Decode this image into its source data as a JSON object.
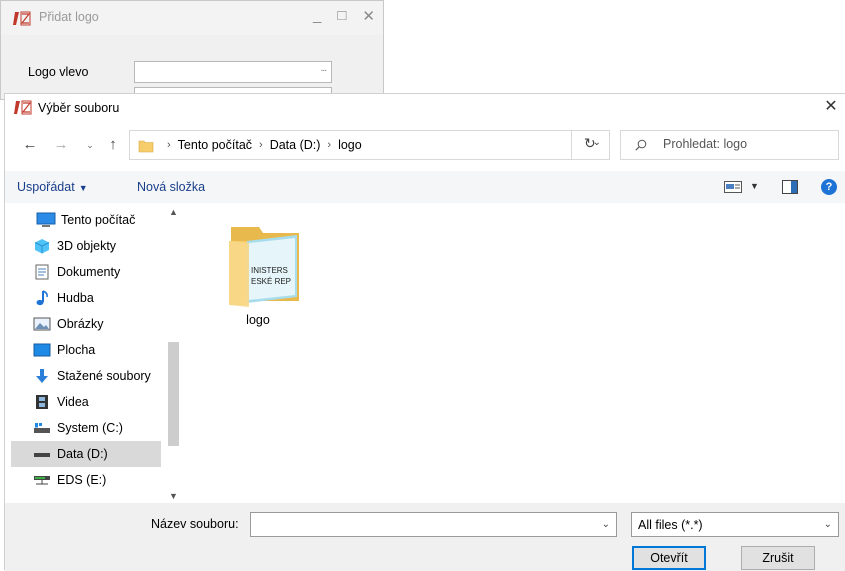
{
  "background_window": {
    "title": "Přidat logo",
    "logo_label": "Logo vlevo",
    "browse_ellipsis": "...",
    "minimize": "_",
    "maximize": "□",
    "close": "✕"
  },
  "dialog": {
    "title": "Výběr souboru",
    "close": "✕",
    "nav": {
      "back": "←",
      "forward": "→",
      "recent": "⌄",
      "up": "↑",
      "breadcrumbs": [
        "Tento počítač",
        "Data (D:)",
        "logo"
      ],
      "breadcrumb_sep": "›",
      "dropdown": "⌄",
      "refresh": "↻",
      "search_placeholder": "Prohledat: logo"
    },
    "toolbar": {
      "organize": "Uspořádat",
      "organize_caret": "▼",
      "new_folder": "Nová složka",
      "view_caret": "▼",
      "help": "?"
    },
    "sidebar": {
      "scroll_up": "▲",
      "scroll_down": "▼",
      "items": [
        {
          "label": "Tento počítač",
          "icon": "computer-icon",
          "selected": false
        },
        {
          "label": "3D objekty",
          "icon": "cube-icon",
          "selected": false
        },
        {
          "label": "Dokumenty",
          "icon": "document-icon",
          "selected": false
        },
        {
          "label": "Hudba",
          "icon": "music-icon",
          "selected": false
        },
        {
          "label": "Obrázky",
          "icon": "picture-icon",
          "selected": false
        },
        {
          "label": "Plocha",
          "icon": "desktop-icon",
          "selected": false
        },
        {
          "label": "Stažené soubory",
          "icon": "download-icon",
          "selected": false
        },
        {
          "label": "Videa",
          "icon": "video-icon",
          "selected": false
        },
        {
          "label": "System (C:)",
          "icon": "system-drive-icon",
          "selected": false
        },
        {
          "label": "Data (D:)",
          "icon": "drive-icon",
          "selected": true
        },
        {
          "label": "EDS (E:)",
          "icon": "network-drive-icon",
          "selected": false
        }
      ]
    },
    "content": {
      "items": [
        {
          "name": "logo",
          "type": "folder",
          "thumb_text": [
            "INISTERS",
            "ESKÉ REP"
          ]
        }
      ]
    },
    "bottom": {
      "filename_label": "Název souboru:",
      "filename_value": "",
      "filename_dropdown": "⌄",
      "filetype": "All files (*.*)",
      "filetype_dropdown": "⌄",
      "open": "Otevřít",
      "cancel": "Zrušit"
    }
  },
  "colors": {
    "accent": "#0078d7",
    "link": "#1a3e8c",
    "selected_bg": "#d9d9d9",
    "toolbar_bg": "#f5f6f7",
    "folder_yellow": "#f6cd6b"
  }
}
